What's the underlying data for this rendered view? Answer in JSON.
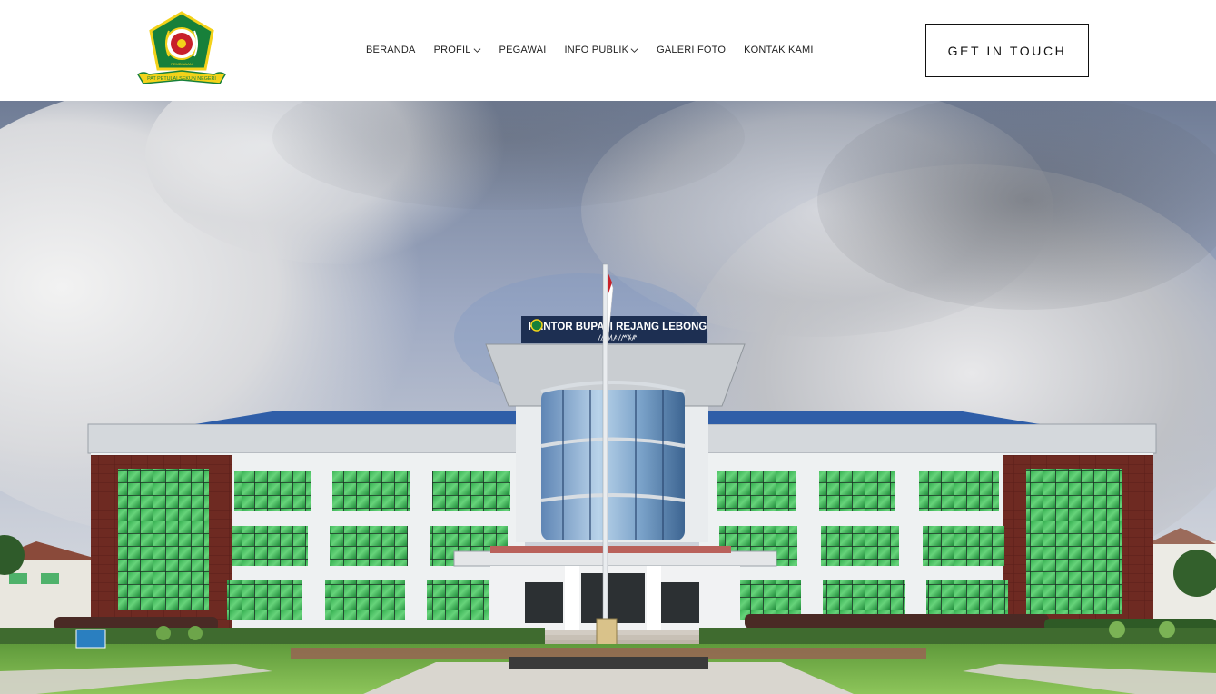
{
  "header": {
    "logo": {
      "icon": "regency-emblem-icon",
      "motto": "PEMBINAAN",
      "ribbon_text": "PAT PETULAI SEKUN NEGERI"
    },
    "nav": [
      {
        "label": "BERANDA",
        "dropdown": false
      },
      {
        "label": "PROFIL",
        "dropdown": true
      },
      {
        "label": "PEGAWAI",
        "dropdown": false
      },
      {
        "label": "INFO PUBLIK",
        "dropdown": true
      },
      {
        "label": "GALERI FOTO",
        "dropdown": false
      },
      {
        "label": "KONTAK KAMI",
        "dropdown": false
      }
    ],
    "cta_label": "GET IN TOUCH"
  },
  "hero": {
    "image": "office-building-photo",
    "building_sign": "KANTOR BUPATI REJANG LEBONG",
    "sign_script": "ꤷꤼꤵꤰꤶꤻꤸꤺ"
  },
  "colors": {
    "accent": "#111111",
    "nav_text": "#222222",
    "emblem_green": "#17803a",
    "emblem_yellow": "#f3d21a",
    "roof_blue": "#2f5ea8",
    "brick": "#6e2a22",
    "glass_green": "#3fbf5a",
    "sign_navy": "#1d2f52"
  }
}
